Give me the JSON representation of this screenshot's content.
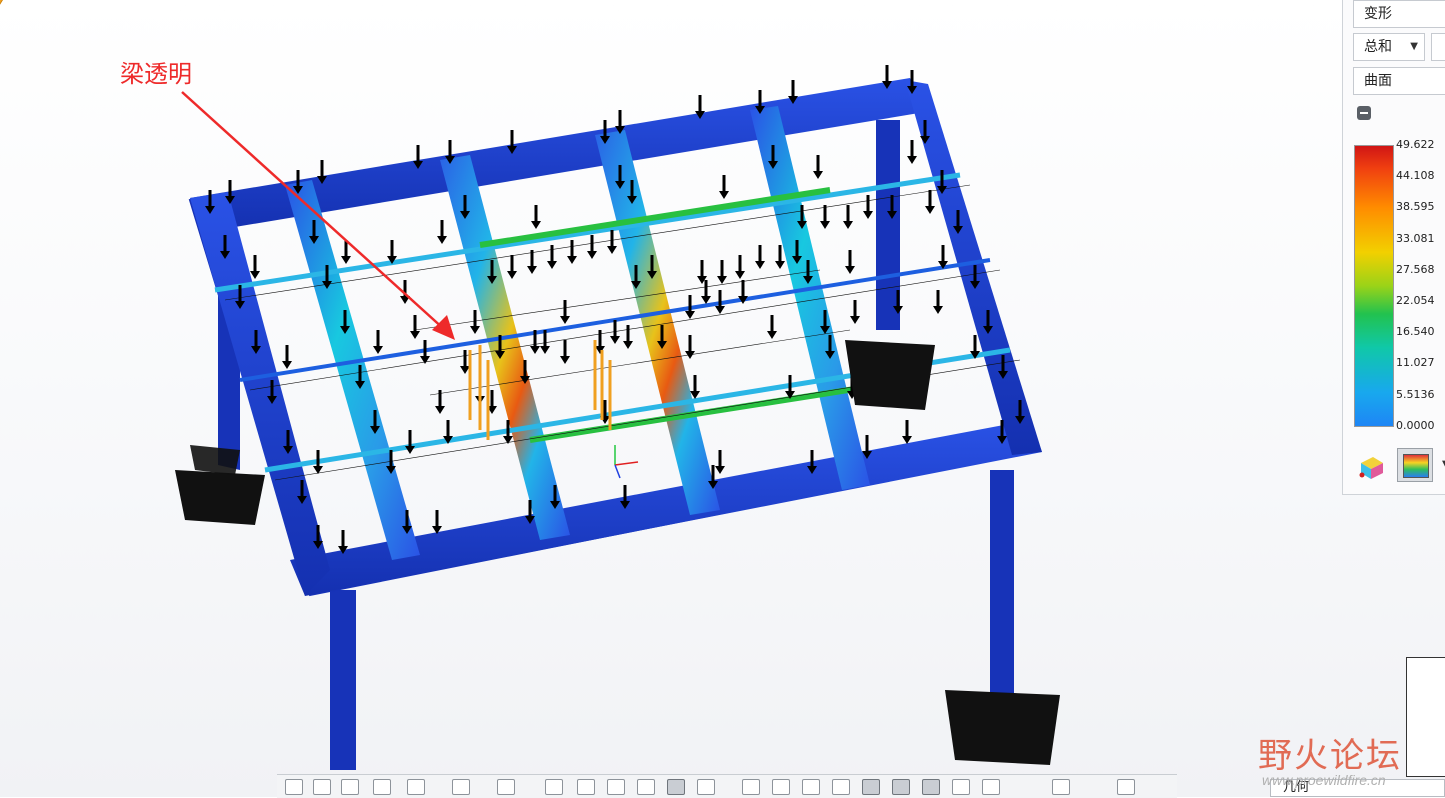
{
  "annotation": {
    "text": "梁透明"
  },
  "panel": {
    "quantity": "变形",
    "component": "总和",
    "display": "曲面"
  },
  "legend": {
    "values": [
      "49.622",
      "44.108",
      "38.595",
      "33.081",
      "27.568",
      "22.054",
      "16.540",
      "11.027",
      "5.5136",
      "0.0000"
    ],
    "colors": {
      "max": "#d01515",
      "mid": "#22c24f",
      "min": "#1e86f5"
    }
  },
  "tabs": {
    "geometry": "几何"
  },
  "watermark": {
    "title": "野火论坛",
    "url": "www.proewildfire.cn"
  },
  "colors": {
    "beam": "#1a39c8",
    "load_arrow": "#f0a020",
    "constraint": "#111111"
  }
}
